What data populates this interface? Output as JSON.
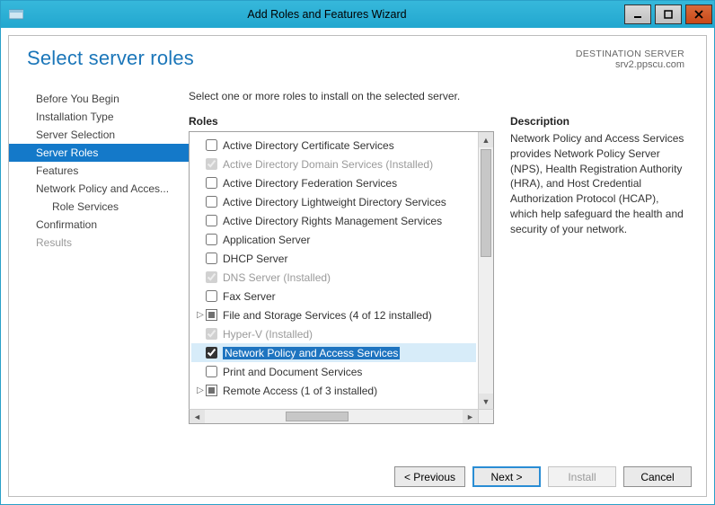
{
  "window": {
    "title": "Add Roles and Features Wizard"
  },
  "page": {
    "title": "Select server roles",
    "dest_label": "DESTINATION SERVER",
    "dest_value": "srv2.ppscu.com",
    "instruction": "Select one or more roles to install on the selected server."
  },
  "sidebar": {
    "items": [
      {
        "label": "Before You Begin",
        "state": "normal"
      },
      {
        "label": "Installation Type",
        "state": "normal"
      },
      {
        "label": "Server Selection",
        "state": "normal"
      },
      {
        "label": "Server Roles",
        "state": "selected"
      },
      {
        "label": "Features",
        "state": "normal"
      },
      {
        "label": "Network Policy and Acces...",
        "state": "normal",
        "trunc": true
      },
      {
        "label": "Role Services",
        "state": "normal",
        "sub": true
      },
      {
        "label": "Confirmation",
        "state": "normal"
      },
      {
        "label": "Results",
        "state": "disabled"
      }
    ]
  },
  "roles": {
    "header": "Roles",
    "items": [
      {
        "label": "Active Directory Certificate Services",
        "checked": false
      },
      {
        "label": "Active Directory Domain Services (Installed)",
        "checked": true,
        "disabled": true
      },
      {
        "label": "Active Directory Federation Services",
        "checked": false
      },
      {
        "label": "Active Directory Lightweight Directory Services",
        "checked": false
      },
      {
        "label": "Active Directory Rights Management Services",
        "checked": false
      },
      {
        "label": "Application Server",
        "checked": false
      },
      {
        "label": "DHCP Server",
        "checked": false
      },
      {
        "label": "DNS Server (Installed)",
        "checked": true,
        "disabled": true
      },
      {
        "label": "Fax Server",
        "checked": false
      },
      {
        "label": "File and Storage Services (4 of 12 installed)",
        "partial": true,
        "expander": true
      },
      {
        "label": "Hyper-V (Installed)",
        "checked": true,
        "disabled": true
      },
      {
        "label": "Network Policy and Access Services",
        "checked": true,
        "selected": true
      },
      {
        "label": "Print and Document Services",
        "checked": false
      },
      {
        "label": "Remote Access (1 of 3 installed)",
        "partial": true,
        "expander": true
      }
    ]
  },
  "description": {
    "header": "Description",
    "text": "Network Policy and Access Services provides Network Policy Server (NPS), Health Registration Authority (HRA), and Host Credential Authorization Protocol (HCAP), which help safeguard the health and security of your network."
  },
  "buttons": {
    "previous": "< Previous",
    "next": "Next >",
    "install": "Install",
    "cancel": "Cancel"
  }
}
